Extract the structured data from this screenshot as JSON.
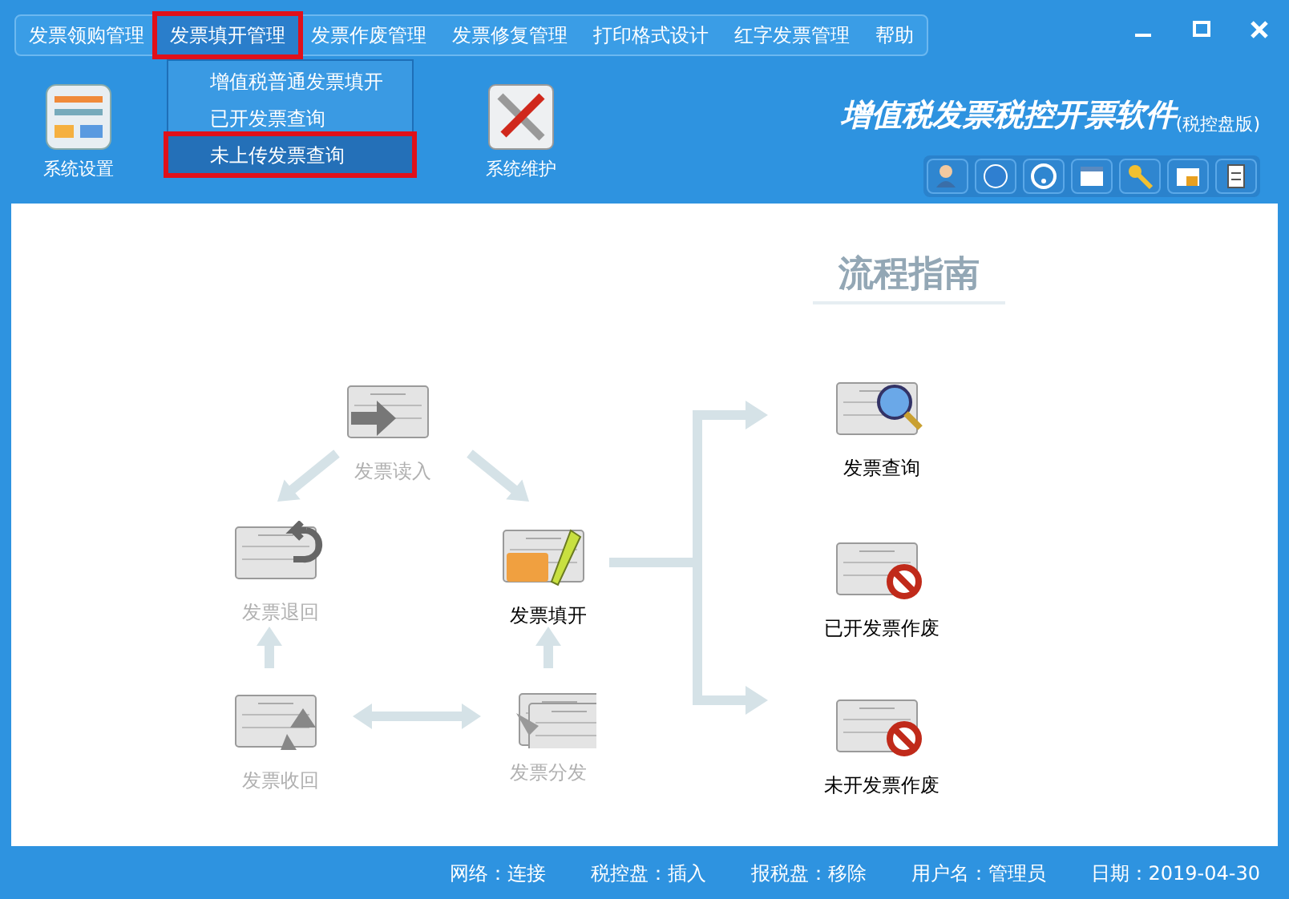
{
  "menu": [
    {
      "label": "发票领购管理",
      "selected": false,
      "highlighted": false
    },
    {
      "label": "发票填开管理",
      "selected": true,
      "highlighted": true
    },
    {
      "label": "发票作废管理",
      "selected": false,
      "highlighted": false
    },
    {
      "label": "发票修复管理",
      "selected": false,
      "highlighted": false
    },
    {
      "label": "打印格式设计",
      "selected": false,
      "highlighted": false
    },
    {
      "label": "红字发票管理",
      "selected": false,
      "highlighted": false
    },
    {
      "label": "帮助",
      "selected": false,
      "highlighted": false
    }
  ],
  "dropdown": [
    {
      "label": "增值税普通发票填开",
      "selected": false,
      "highlighted": false
    },
    {
      "label": "已开发票查询",
      "selected": false,
      "highlighted": false
    },
    {
      "label": "未上传发票查询",
      "selected": true,
      "highlighted": true
    }
  ],
  "toolbar": [
    {
      "label": "系统设置",
      "kind": "settings"
    },
    {
      "label": "系统维护",
      "kind": "tools"
    }
  ],
  "brand": {
    "title": "增值税发票税控开票软件",
    "edition": "(税控盘版)"
  },
  "guide": {
    "heading": "流程指南",
    "nodes": [
      {
        "label": "发票读入",
        "kind": "read",
        "enabled": false
      },
      {
        "label": "发票退回",
        "kind": "return",
        "enabled": false
      },
      {
        "label": "发票填开",
        "kind": "fill",
        "enabled": true
      },
      {
        "label": "发票收回",
        "kind": "recover",
        "enabled": false
      },
      {
        "label": "发票分发",
        "kind": "distribute",
        "enabled": false
      },
      {
        "label": "发票查询",
        "kind": "query",
        "enabled": true
      },
      {
        "label": "已开发票作废",
        "kind": "void",
        "enabled": true
      },
      {
        "label": "未开发票作废",
        "kind": "void",
        "enabled": true
      }
    ]
  },
  "status_bar": [
    "网络：连接",
    "税控盘：插入",
    "报税盘：移除",
    "用户名：管理员",
    "日期：2019-04-30"
  ]
}
